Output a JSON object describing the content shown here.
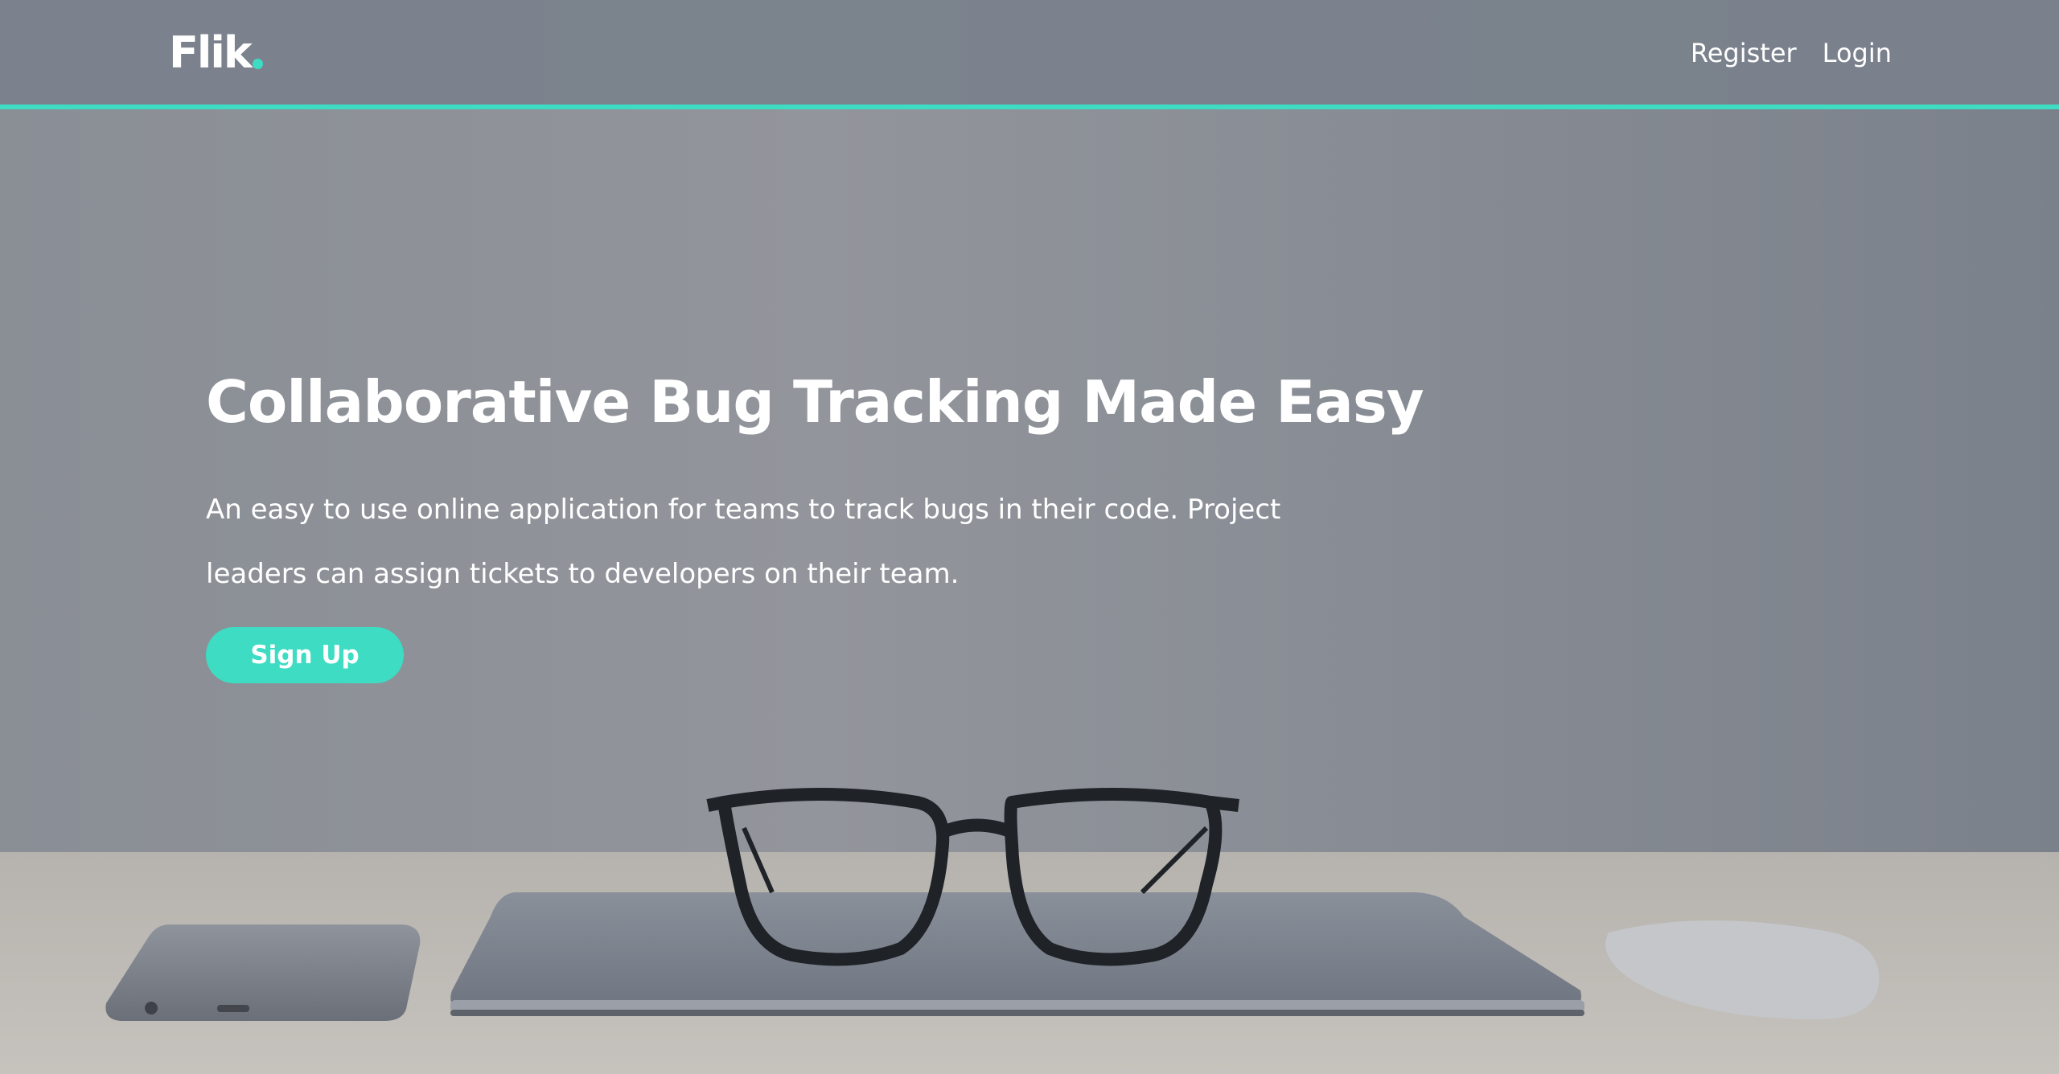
{
  "header": {
    "logo": "Flik",
    "nav": {
      "register": "Register",
      "login": "Login"
    }
  },
  "hero": {
    "title": "Collaborative Bug Tracking Made Easy",
    "description": "An easy to use online application for teams to track bugs in their code. Project leaders can assign tickets to developers on their team.",
    "cta": "Sign Up"
  },
  "colors": {
    "accent": "#3ddcc3",
    "header_bg": "#7a818c",
    "text": "#ffffff"
  }
}
